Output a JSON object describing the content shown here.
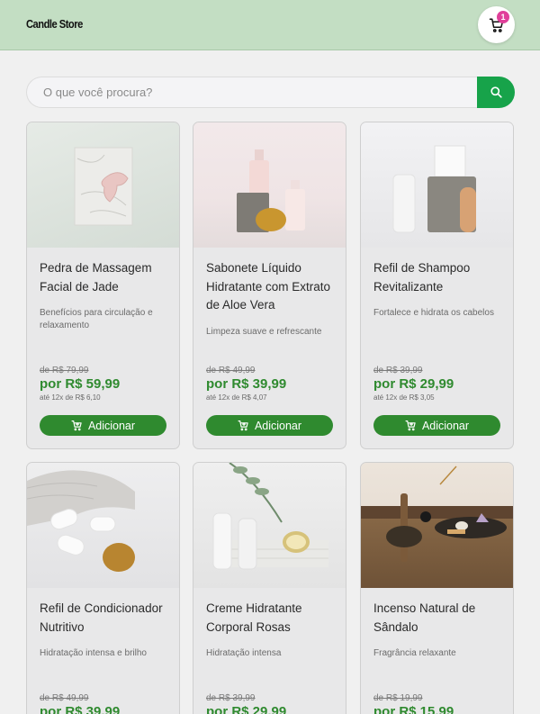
{
  "header": {
    "brand": "Candle Store",
    "cart_count": "1"
  },
  "search": {
    "placeholder": "O que você procura?"
  },
  "add_label": "Adicionar",
  "products": [
    {
      "title": "Pedra de Massagem Facial de Jade",
      "description": "Benefícios para circulação e relaxamento",
      "old_price": "de R$ 79,99",
      "price": "por R$ 59,99",
      "installment": "até 12x de R$ 6,10"
    },
    {
      "title": "Sabonete Líquido Hidratante com Extrato de Aloe Vera",
      "description": "Limpeza suave e refrescante",
      "old_price": "de R$ 49,99",
      "price": "por R$ 39,99",
      "installment": "até 12x de R$ 4,07"
    },
    {
      "title": "Refil de Shampoo Revitalizante",
      "description": "Fortalece e hidrata os cabelos",
      "old_price": "de R$ 39,99",
      "price": "por R$ 29,99",
      "installment": "até 12x de R$ 3,05"
    },
    {
      "title": "Refil de Condicionador Nutritivo",
      "description": "Hidratação intensa e brilho",
      "old_price": "de R$ 49,99",
      "price": "por R$ 39,99",
      "installment": ""
    },
    {
      "title": "Creme Hidratante Corporal Rosas",
      "description": "Hidratação intensa",
      "old_price": "de R$ 39,99",
      "price": "por R$ 29,99",
      "installment": ""
    },
    {
      "title": "Incenso Natural de Sândalo",
      "description": "Fragrância relaxante",
      "old_price": "de R$ 19,99",
      "price": "por R$ 15,99",
      "installment": ""
    }
  ],
  "colors": {
    "header_bg": "#c3dec3",
    "accent_green": "#2f8a2f",
    "search_button": "#17a34a",
    "badge": "#e0409a"
  },
  "icons": {
    "cart": "cart-icon",
    "search": "search-icon",
    "add_to_cart": "cart-plus-icon"
  }
}
